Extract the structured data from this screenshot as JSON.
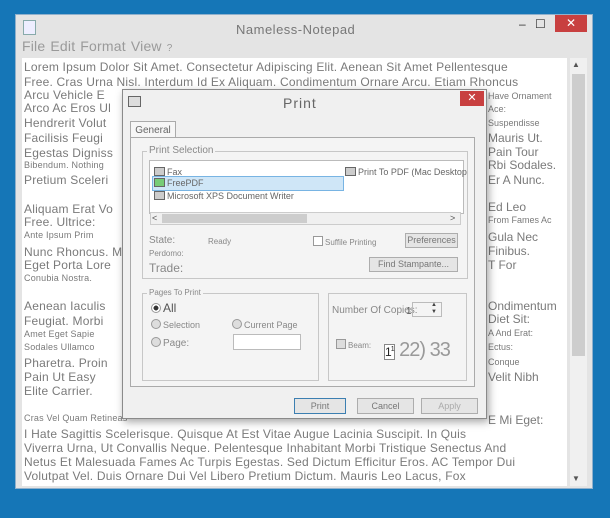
{
  "notepad": {
    "title": "Nameless-Notepad",
    "minimize": "–",
    "maximize": "☐",
    "close": "✕",
    "menu": [
      "File",
      "Edit",
      "Format",
      "View",
      "?"
    ],
    "left_lines": [
      "Lorem Ipsum Dolor Sit Amet. Consectetur Adipiscing Elit. Aenean Sit Amet Pellentesque",
      "Free. Cras Urna Nisl. Interdum Id Ex Aliquam. Condimentum Ornare Arcu. Etiam Rhoncus",
      "Arcu Vehicle E",
      "Arco Ac Eros Ul",
      "Hendrerit Volut",
      "Facilisis Feugi",
      "Egestas Digniss",
      "Bibendum. Nothing",
      "Pretium Sceleri",
      "",
      "Aliquam Erat Vo",
      "Free. Ultrice:",
      "Ante Ipsum Prim",
      "Nunc Rhoncus. M",
      "Eget Porta Lore",
      "Conubia Nostra.",
      "",
      "Aenean Iaculis",
      "Feugiat. Morbi",
      "Amet Eget Sapie",
      "Sodales Ullamco",
      "Pharetra. Proin",
      "Pain Ut Easy",
      "Elite Carrier.",
      "",
      "Cras Vel Quam Retineas",
      "I Hate Sagittis Scelerisque. Quisque At Est Vitae Augue Lacinia Suscipit. In Quis",
      "Viverra Urna, Ut Convallis Neque. Pelentesque Inhabitant Morbi Tristique Senectus And",
      "Netus Et Malesuada Fames Ac Turpis Egestas. Sed Dictum Efficitur Eros. AC Tempor Dui",
      "Volutpat Vel. Duis Ornare Dui Vel Libero Pretium Dictum. Mauris Leo Lacus, Fox"
    ],
    "right_lines": [
      "Have Ornament",
      "Ace:",
      "Suspendisse",
      "Mauris Ut.",
      "Pain Tour",
      "Rbi Sodales.",
      "Er A Nunc.",
      "",
      "Ed Leo",
      "From Fames Ac",
      "Gula Nec",
      "Finibus.",
      "T For",
      "",
      "Ondimentum",
      "Diet Sit:",
      "A And Erat:",
      "Ectus:",
      "Conque",
      "Velit Nibh",
      "",
      "E Mi Eget:"
    ]
  },
  "print_dialog": {
    "title": "Print",
    "close": "✕",
    "tab": "General",
    "print_selection": "Print Selection",
    "printers": [
      "Fax",
      "FreePDF",
      "Microsoft XPS Document Writer",
      "Print To PDF (Mac Desktop"
    ],
    "state_label": "State:",
    "state_value": "Ready",
    "perdomo_label": "Perdomo:",
    "trade_label": "Trade:",
    "print_to_file": "Suffile Printing",
    "preferences": "Preferences",
    "find_printer": "Find Stampante...",
    "pages_to_print": "Pages To Print",
    "all": "All",
    "selection": "Selection",
    "current_page": "Current Page",
    "page": "Page:",
    "copies_label": "Number Of Copies:",
    "copies_value": "1",
    "collate": "Beam:",
    "print_btn": "Print",
    "cancel_btn": "Cancel",
    "apply_btn": "Apply"
  }
}
